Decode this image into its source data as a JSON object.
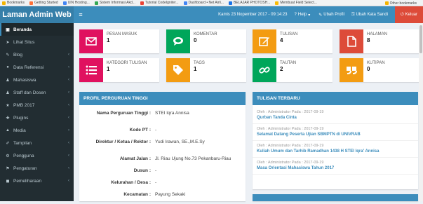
{
  "bookmarks": [
    {
      "label": "Bookmarks",
      "color": "#f4b400"
    },
    {
      "label": "Getting Started",
      "color": "#ff7139"
    },
    {
      "label": "UIN Hosting...",
      "color": "#4285f4"
    },
    {
      "label": "Sistem Informasi Akd...",
      "color": "#34a853"
    },
    {
      "label": "Tutorial CodeIgniter...",
      "color": "#ea4335"
    },
    {
      "label": "Dashboard • Net Airli...",
      "color": "#4285f4"
    },
    {
      "label": "BELAJAR PHOTOSH...",
      "color": "#1a73e8"
    },
    {
      "label": "Membuat Field Select...",
      "color": "#fbbc05"
    }
  ],
  "bookmarks_right": "Other bookmarks",
  "brand": "Laman Admin Web",
  "topnav": {
    "toggle_icon": "≡",
    "datetime": "Kamis 23 Nopember 2017 - 09:14:23",
    "help": "Help",
    "profile": "Ubah Profil",
    "password": "Ubah Kata Sandi",
    "logout": "Keluar"
  },
  "sidebar": [
    {
      "label": "Beranda",
      "icon": "▣",
      "active": true,
      "chevron": ""
    },
    {
      "label": "Lihat Situs",
      "icon": "➤",
      "active": false,
      "chevron": ""
    },
    {
      "label": "Blog",
      "icon": "✎",
      "active": false,
      "chevron": "‹"
    },
    {
      "label": "Data Referensi",
      "icon": "●",
      "active": false,
      "chevron": "‹"
    },
    {
      "label": "Mahasiswa",
      "icon": "♟",
      "active": false,
      "chevron": "‹"
    },
    {
      "label": "Staff dan Dosen",
      "icon": "♟",
      "active": false,
      "chevron": "‹"
    },
    {
      "label": "PMB 2017",
      "icon": "★",
      "active": false,
      "chevron": "‹"
    },
    {
      "label": "Plugins",
      "icon": "✚",
      "active": false,
      "chevron": "‹"
    },
    {
      "label": "Media",
      "icon": "▲",
      "active": false,
      "chevron": "‹"
    },
    {
      "label": "Tampilan",
      "icon": "✐",
      "active": false,
      "chevron": "‹"
    },
    {
      "label": "Pengguna",
      "icon": "⚙",
      "active": false,
      "chevron": "‹"
    },
    {
      "label": "Pengaturan",
      "icon": "⚑",
      "active": false,
      "chevron": "‹"
    },
    {
      "label": "Pemeliharaan",
      "icon": "◼",
      "active": false,
      "chevron": "‹"
    }
  ],
  "stats": [
    {
      "title": "PESAN MASUK",
      "value": "1",
      "color": "#e0115f",
      "icon": "envelope-icon"
    },
    {
      "title": "KOMENTAR",
      "value": "0",
      "color": "#00a65a",
      "icon": "comments-icon"
    },
    {
      "title": "TULISAN",
      "value": "4",
      "color": "#f39c12",
      "icon": "edit-icon"
    },
    {
      "title": "HALAMAN",
      "value": "8",
      "color": "#dd4b39",
      "icon": "file-icon"
    },
    {
      "title": "KATEGORI TULISAN",
      "value": "1",
      "color": "#e0115f",
      "icon": "list-icon"
    },
    {
      "title": "TAGS",
      "value": "1",
      "color": "#f39c12",
      "icon": "tags-icon"
    },
    {
      "title": "TAUTAN",
      "value": "2",
      "color": "#00a65a",
      "icon": "link-icon"
    },
    {
      "title": "KUTIPAN",
      "value": "0",
      "color": "#f39c12",
      "icon": "quote-icon"
    }
  ],
  "profile_panel": {
    "title": "PROFIL PERGURUAN TINGGI",
    "rows": [
      {
        "k": "Nama Perguruan Tinggi :",
        "v": "STEI Iqra Annisa"
      },
      {
        "k": "Kode PT :",
        "v": "-"
      },
      {
        "k": "Direktur / Ketua / Rektor :",
        "v": "Yudi Irawan, SE.,M.E.Sy"
      },
      {
        "k": "Alamat Jalan :",
        "v": "Jl. Riau Ujung No.73 Pekanbaru-Riau"
      },
      {
        "k": "Dusun :",
        "v": "-"
      },
      {
        "k": "Kelurahan / Desa :",
        "v": "-"
      },
      {
        "k": "Kecamatan :",
        "v": "Payung Sekaki"
      }
    ]
  },
  "posts_panel": {
    "title": "TULISAN TERBARU",
    "posts": [
      {
        "meta": "Oleh : Administrator Pada : 2017-09-19",
        "title": "Qurban Tanda Cinta"
      },
      {
        "meta": "Oleh : Administrator Pada : 2017-09-19",
        "title": "Selamat Datang Peserta Ujian SBMPTN di UNIVRAB"
      },
      {
        "meta": "Oleh : Administrator Pada : 2017-09-19",
        "title": "Kuliah Umum dan Tarhib Ramadhan 1438 H STEI Iqra' Annisa"
      },
      {
        "meta": "Oleh : Administrator Pada : 2017-09-19",
        "title": "Masa Orientasi Mahasiswa Tahun 2017"
      }
    ]
  }
}
